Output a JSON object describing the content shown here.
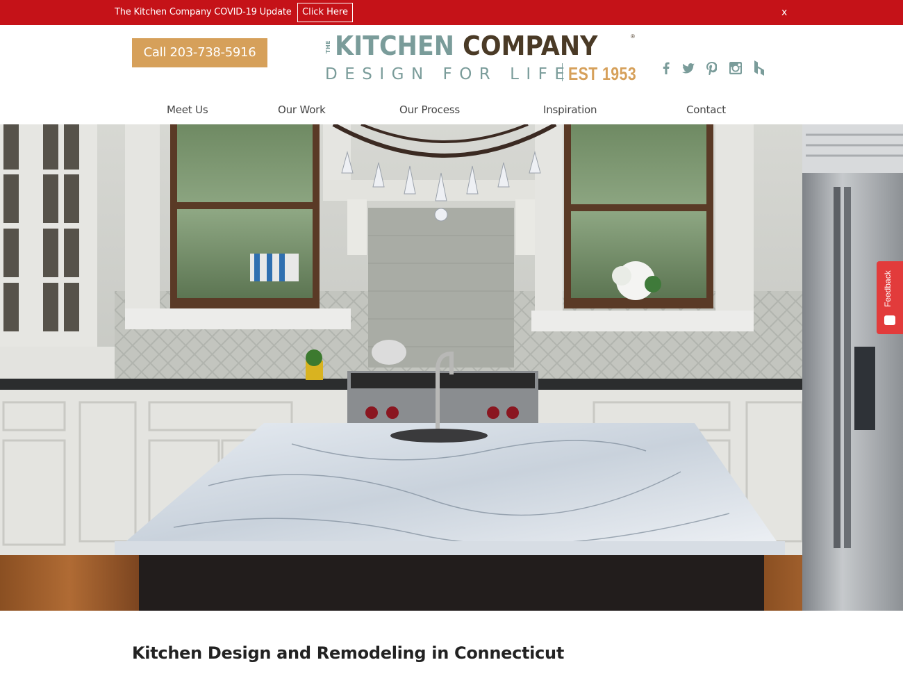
{
  "alert": {
    "text": "The Kitchen Company COVID-19 Update",
    "button_label": "Click Here",
    "close_label": "x"
  },
  "header": {
    "call_label": "Call 203-738-5916",
    "logo": {
      "the": "THE",
      "word1": "KITCHEN",
      "word2": "COMPANY",
      "registered": "®",
      "tagline": "DESIGN FOR LIFE",
      "est": "EST 1953"
    },
    "socials": [
      "facebook-icon",
      "twitter-icon",
      "pinterest-icon",
      "instagram-icon",
      "houzz-icon"
    ]
  },
  "nav": {
    "items": [
      {
        "label": "Meet Us"
      },
      {
        "label": "Our Work"
      },
      {
        "label": "Our Process"
      },
      {
        "label": "Inspiration"
      },
      {
        "label": "Contact"
      }
    ]
  },
  "feedback": {
    "label": "Feedback"
  },
  "main": {
    "heading": "Kitchen Design and Remodeling in Connecticut"
  },
  "colors": {
    "alert": "#c51218",
    "accent": "#d6a05a",
    "logo_teal": "#7a9c9a",
    "logo_brown": "#4a3a26",
    "feedback": "#e23b3b"
  }
}
